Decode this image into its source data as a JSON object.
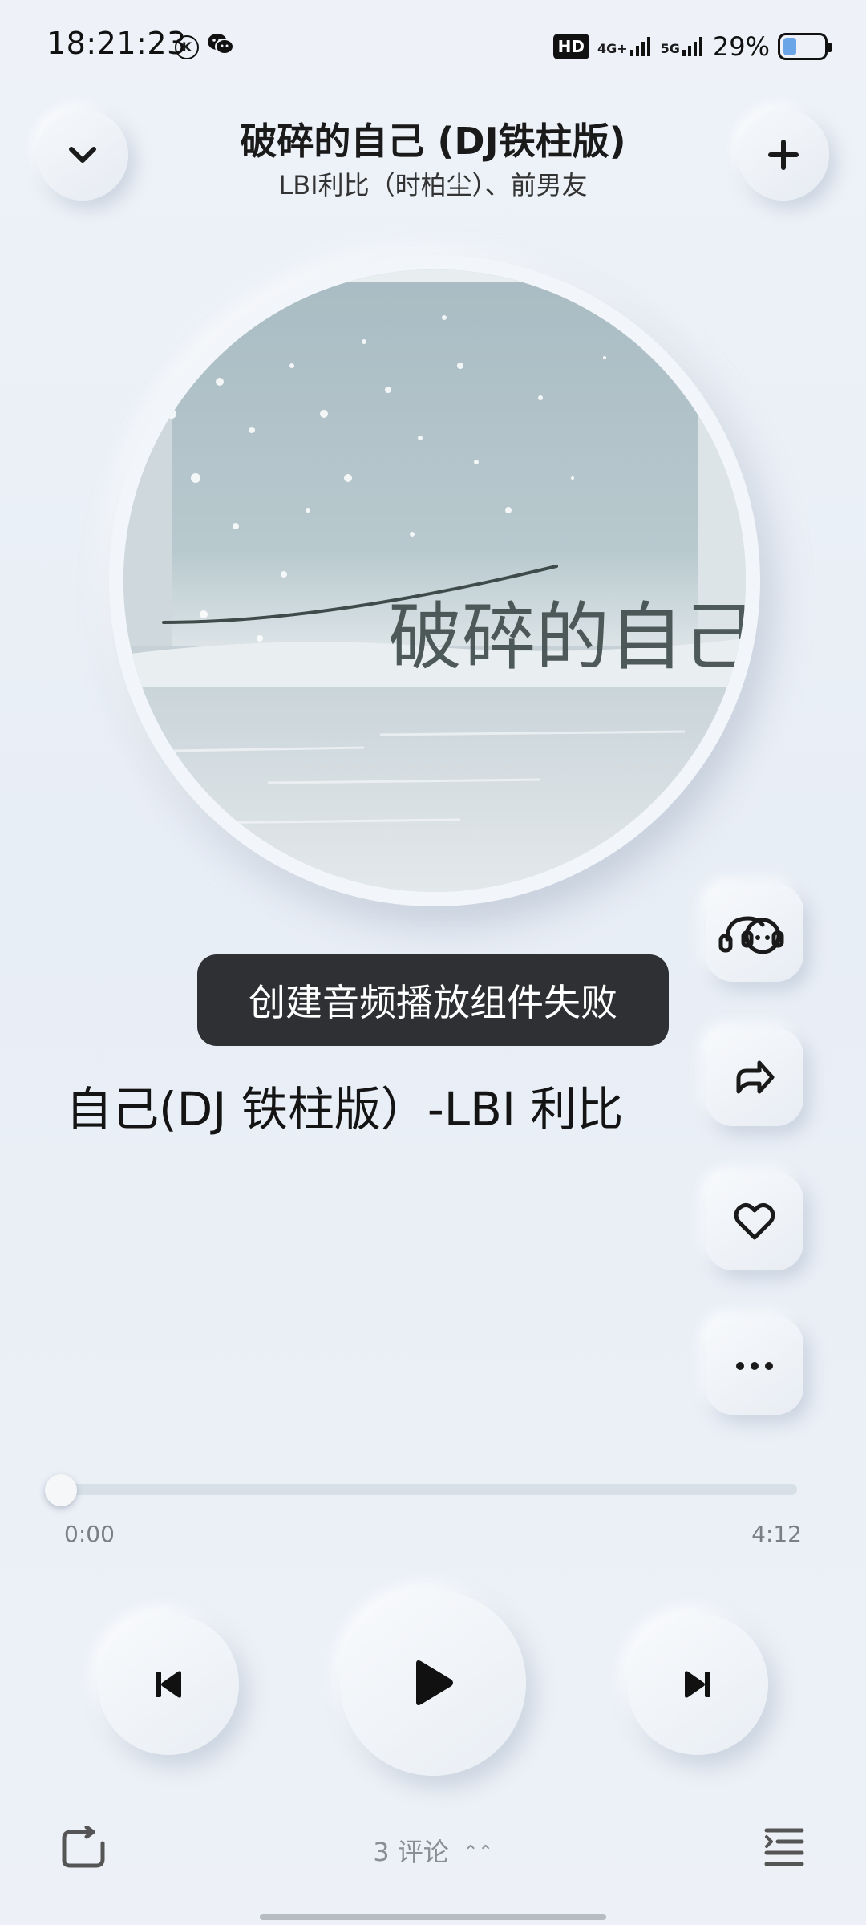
{
  "status_bar": {
    "time": "18:21:23",
    "k_badge": "K",
    "hd_badge": "HD",
    "network_1": "4G+",
    "network_2": "5G",
    "battery_percent": "29%"
  },
  "header": {
    "title": "破碎的自己 (DJ铁柱版)",
    "artists": "LBI利比（时柏尘）、前男友"
  },
  "album": {
    "art_text": "破碎的自己"
  },
  "toast": {
    "message": "创建音频播放组件失败"
  },
  "lyrics": {
    "current_line": "自己(DJ 铁柱版）-LBI 利比"
  },
  "progress": {
    "current_time": "0:00",
    "total_time": "4:12",
    "fraction": 0
  },
  "bottom_bar": {
    "comments_count": "3",
    "comments_label": "评论",
    "chevron": "⌃⌃"
  },
  "icons": {
    "collapse": "chevron-down-icon",
    "add": "plus-icon",
    "listen_together": "listen-together-icon",
    "share": "share-icon",
    "like": "heart-icon",
    "more": "more-icon",
    "prev": "skip-previous-icon",
    "play": "play-icon",
    "next": "skip-next-icon",
    "repeat": "repeat-icon",
    "playlist": "playlist-icon"
  },
  "colors": {
    "background": "#eef2f8",
    "toast_bg": "#2e3033",
    "progress_track": "#d6e0e6",
    "text_primary": "#1a1a1a",
    "text_secondary": "#8a8e95"
  }
}
